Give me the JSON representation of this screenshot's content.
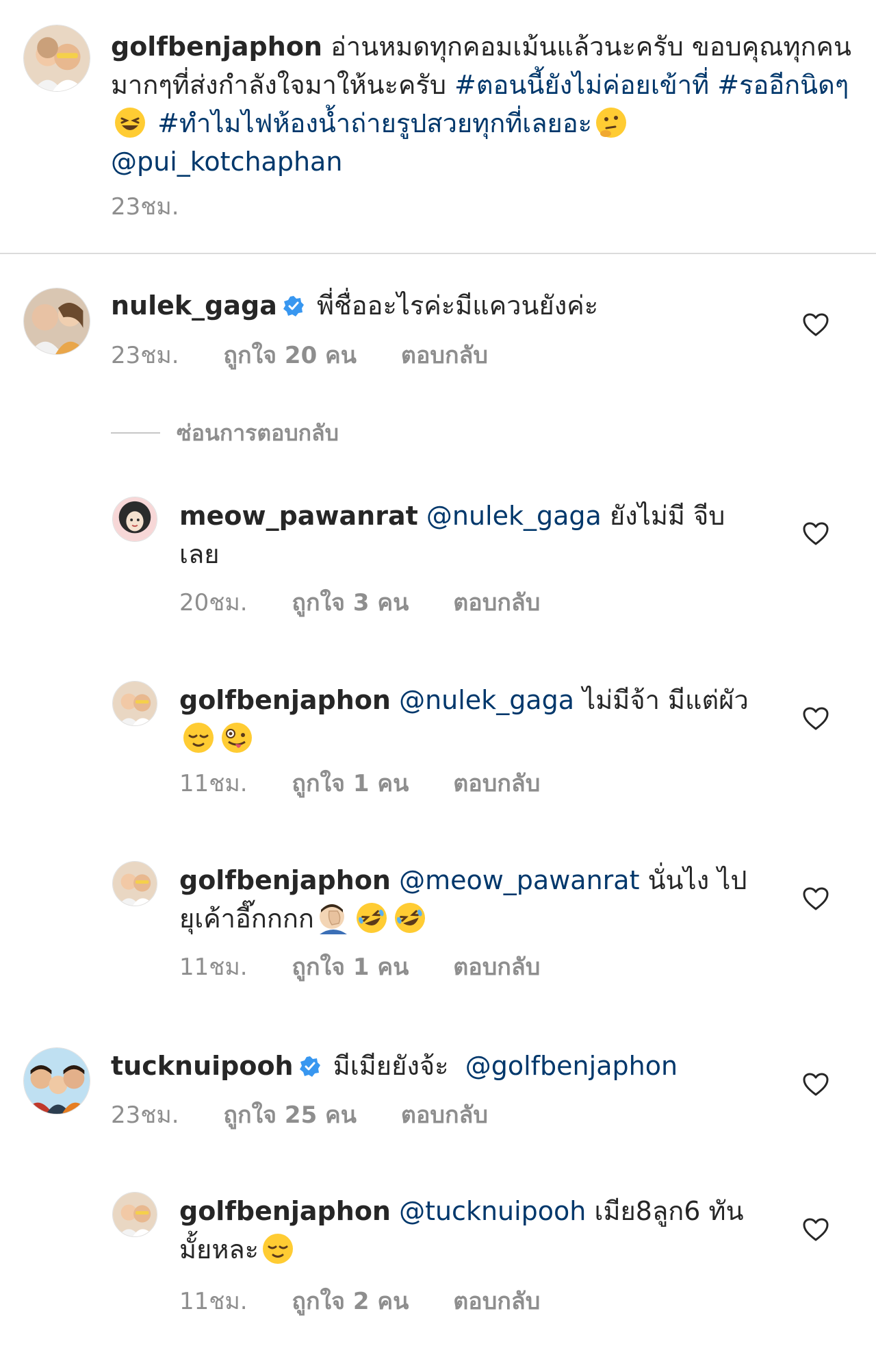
{
  "caption": {
    "username": "golfbenjaphon",
    "text": "อ่านหมดทุกคอมเม้นแล้วนะครับ ขอบคุณทุกคนมากๆที่ส่งกำลังใจมาให้นะครับ",
    "hashtag_1": "#ตอนนี้ยังไม่ค่อยเข้าที่",
    "hashtag_2": "#รออีกนิดๆ",
    "hashtag_3": "#ทำไมไฟห้องน้ำถ่ายรูปสวยทุกที่เลยอะ",
    "mention": "@pui_kotchaphan",
    "time": "23ชม."
  },
  "comments": [
    {
      "username": "nulek_gaga",
      "text": "พี่ชื่ออะไรค่ะมีแควนยังค่ะ",
      "time": "23ชม.",
      "likes": "ถูกใจ 20 คน",
      "reply_label": "ตอบกลับ"
    },
    {
      "username": "tucknuipooh",
      "text": "มีเมียยังจ้ะ",
      "mention": "@golfbenjaphon",
      "time": "23ชม.",
      "likes": "ถูกใจ 25 คน",
      "reply_label": "ตอบกลับ"
    }
  ],
  "hide_replies_label": "ซ่อนการตอบกลับ",
  "replies": [
    {
      "username": "meow_pawanrat",
      "mention": "@nulek_gaga",
      "text": "ยังไม่มี จีบเลย",
      "time": "20ชม.",
      "likes": "ถูกใจ 3 คน",
      "reply_label": "ตอบกลับ"
    },
    {
      "username": "golfbenjaphon",
      "mention": "@nulek_gaga",
      "text": "ไม่มีจ้า มีแต่ผัว",
      "time": "11ชม.",
      "likes": "ถูกใจ 1 คน",
      "reply_label": "ตอบกลับ"
    },
    {
      "username": "golfbenjaphon",
      "mention": "@meow_pawanrat",
      "text": "นั่นไง ไปยุเค้าอี๊กกกก",
      "time": "11ชม.",
      "likes": "ถูกใจ 1 คน",
      "reply_label": "ตอบกลับ"
    },
    {
      "username": "golfbenjaphon",
      "mention": "@tucknuipooh",
      "text": "เมีย8ลูก6 ทันมั้ยหละ",
      "time": "11ชม.",
      "likes": "ถูกใจ 2 คน",
      "reply_label": "ตอบกลับ"
    }
  ],
  "icons": {
    "like": "heart-outline-icon",
    "verified": "verified-badge-icon",
    "emoji_laughing": "grinning-squinting-face-emoji",
    "emoji_thinking": "thinking-face-emoji",
    "emoji_relieved": "relieved-face-emoji",
    "emoji_zany": "zany-face-emoji",
    "emoji_facepalm": "facepalm-emoji",
    "emoji_rofl": "rolling-on-floor-laughing-emoji"
  },
  "colors": {
    "text": "#262626",
    "secondary": "#8e8e8e",
    "link": "#00376b",
    "verified": "#3897f0",
    "divider": "#dbdbdb"
  }
}
